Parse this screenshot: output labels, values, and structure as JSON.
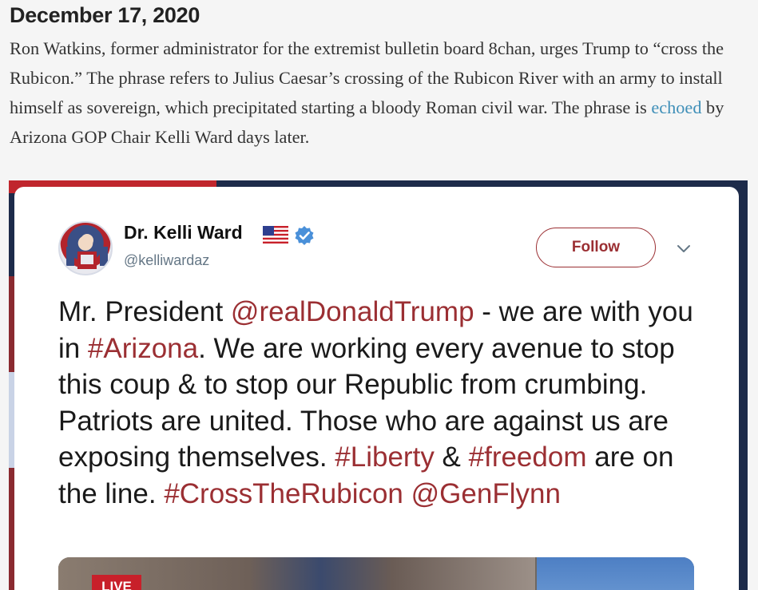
{
  "article": {
    "date": "December 17, 2020",
    "paragraph_before_link": "Ron Watkins, former administrator for the extremist bulletin board 8chan, urges Trump to “cross the Rubicon.” The phrase refers to Julius Caesar’s crossing of the Rubicon River with an army to install himself as sovereign, which precipitated starting a bloody Roman civil war. The phrase is ",
    "link_text": "echoed",
    "paragraph_after_link": " by Arizona GOP Chair Kelli Ward days later."
  },
  "tweet": {
    "display_name": "Dr. Kelli Ward",
    "handle": "@kelliwardaz",
    "follow_label": "Follow",
    "text": {
      "t1": "Mr. President ",
      "m1": "@realDonaldTrump",
      "t2": " - we are with you in ",
      "h1": "#Arizona",
      "t3": ". We are working every avenue to stop this coup & to stop our Republic from crumbing. Patriots are united. Those who are against us are exposing themselves. ",
      "h2": "#Liberty",
      "t4": " & ",
      "h3": "#freedom",
      "t5": " are on the line. ",
      "h4": "#CrossTheRubicon",
      "t6": " ",
      "m2": "@GenFlynn"
    },
    "media_badge": "LIVE"
  },
  "icons": {
    "flag": "us-flag-icon",
    "verified": "verified-badge-icon",
    "chevron": "chevron-down-icon"
  },
  "colors": {
    "link_article": "#3f8fb8",
    "link_tweet": "#9b2f33",
    "verified_blue": "#4a90d9",
    "live_red": "#c8202a"
  }
}
